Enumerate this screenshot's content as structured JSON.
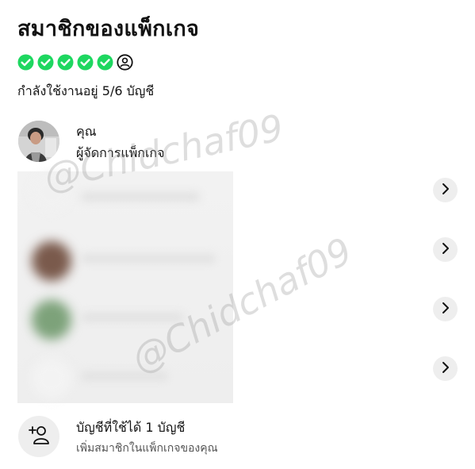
{
  "header": {
    "title": "สมาชิกของแพ็กเกจ"
  },
  "slots": {
    "used_count": 5,
    "total_count": 6,
    "used_color": "#1ed760",
    "icons": [
      "check-circle",
      "check-circle",
      "check-circle",
      "check-circle",
      "check-circle",
      "user-outline"
    ]
  },
  "usage_text": "กำลังใช้งานอยู่ 5/6 บัญชี",
  "members": [
    {
      "name": "คุณ",
      "role": "ผู้จัดการแพ็กเกจ",
      "avatar": "photo"
    },
    {
      "avatar_color": "#f1f1f1",
      "blurred": true
    },
    {
      "avatar_color": "#7a5a4c",
      "blurred": true
    },
    {
      "avatar_color": "#7da27a",
      "blurred": true
    },
    {
      "avatar_color": "#f3f3f3",
      "blurred": true
    }
  ],
  "add_member": {
    "title": "บัญชีที่ใช้ได้ 1 บัญชี",
    "subtitle": "เพิ่มสมาชิกในแพ็กเกจของคุณ"
  },
  "watermark": "@Chidchaf09"
}
